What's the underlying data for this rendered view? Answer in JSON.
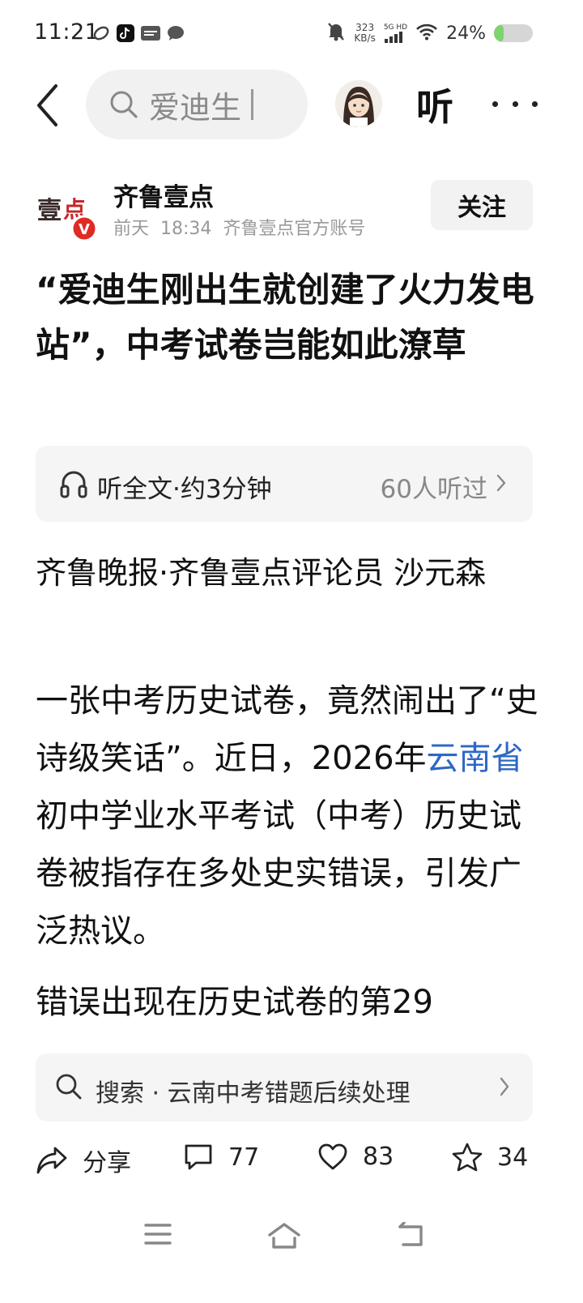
{
  "status_bar": {
    "time": "11:21",
    "net_speed_value": "323",
    "net_speed_unit": "KB/s",
    "signal_label": "5G HD",
    "battery": "24%",
    "battery_level": 0.24
  },
  "nav": {
    "search_query": "爱迪生",
    "listen_label": "听"
  },
  "author": {
    "name": "齐鲁壹点",
    "date": "前天",
    "time": "18:34",
    "account_type": "齐鲁壹点官方账号",
    "follow_label": "关注",
    "logo_text": "壹点",
    "verified_badge": "V"
  },
  "article": {
    "title": "“爱迪生刚出生就创建了火力发电站”，中考试卷岂能如此潦草",
    "listen_full": "听全文·约3分钟",
    "listen_count": "60人听过",
    "byline": "齐鲁晚报·齐鲁壹点评论员 沙元森",
    "para1_before": "一张中考历史试卷，竟然闹出了“史诗级笑话”。近日，2026年",
    "para1_link": "云南省",
    "para1_after": "初中学业水平考试（中考）历史试卷被指存在多处史实错误，引发广泛热议。",
    "para2": "错误出现在历史试卷的第29"
  },
  "related_search": {
    "text": "搜索 · 云南中考错题后续处理"
  },
  "actions": {
    "share_label": "分享",
    "comments": "77",
    "likes": "83",
    "favorites": "34"
  },
  "colors": {
    "link": "#2d68c4",
    "battery_fill": "#7ed36e",
    "verified_red": "#e02a25"
  }
}
